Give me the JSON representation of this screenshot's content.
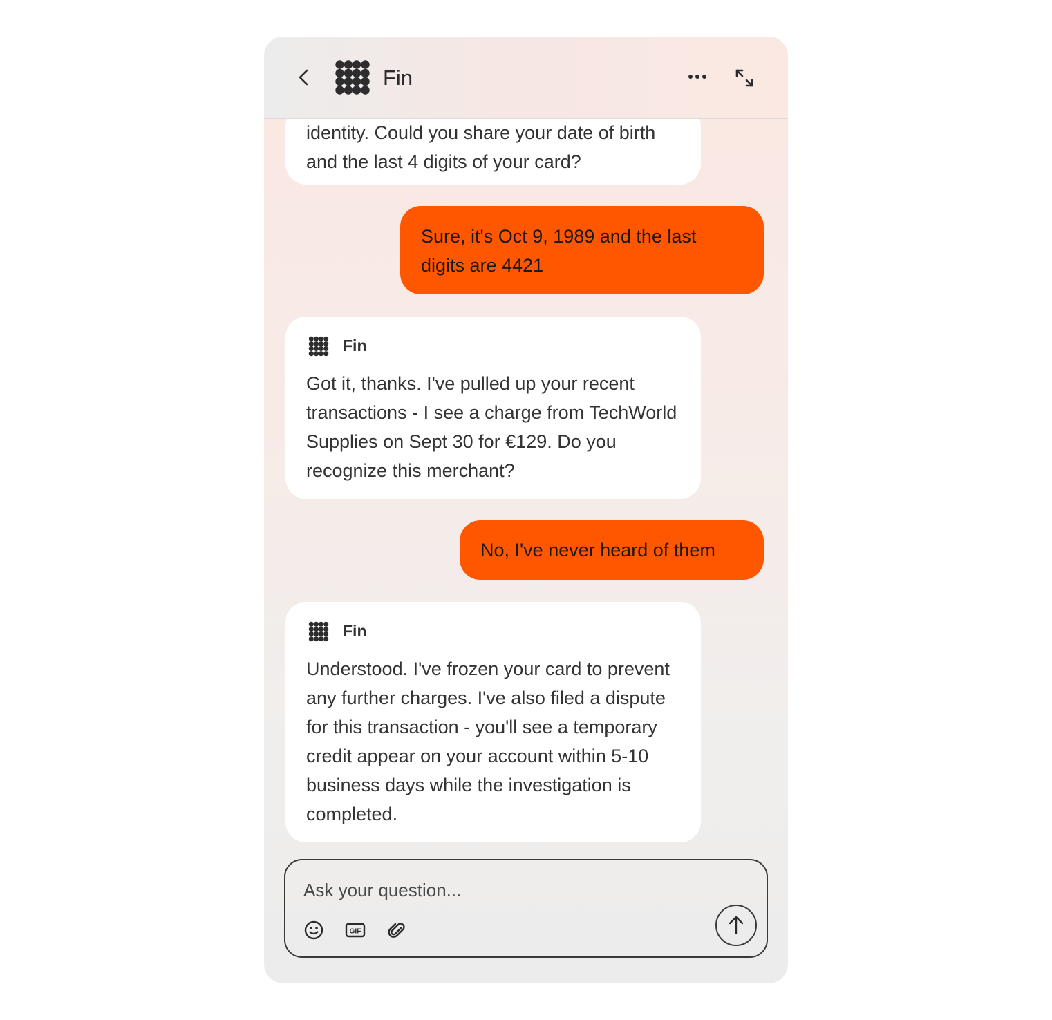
{
  "header": {
    "title": "Fin",
    "back_icon": "chevron-left-icon",
    "logo_icon": "fin-logo-icon",
    "more_icon": "more-horizontal-icon",
    "expand_icon": "expand-icon"
  },
  "messages": [
    {
      "role": "bot",
      "show_header": false,
      "text": "identity. Could you share your date of birth and the last 4 digits of your card?"
    },
    {
      "role": "user",
      "text": "Sure, it's Oct 9, 1989 and the last digits are 4421"
    },
    {
      "role": "bot",
      "show_header": true,
      "sender": "Fin",
      "text": "Got it, thanks. I've pulled up your recent transactions - I see a charge from TechWorld Supplies on Sept 30 for €129. Do you recognize this merchant?"
    },
    {
      "role": "user",
      "text": "No, I've never heard of them"
    },
    {
      "role": "bot",
      "show_header": true,
      "sender": "Fin",
      "text": "Understood. I've frozen your card to prevent any further charges. I've also filed a dispute for this transaction - you'll see a temporary credit appear on your account within 5-10 business days while the investigation is completed."
    }
  ],
  "composer": {
    "placeholder": "Ask your question...",
    "value": "",
    "tools": [
      "emoji-icon",
      "gif-icon",
      "paperclip-icon"
    ],
    "send_icon": "arrow-up-icon"
  },
  "colors": {
    "accent": "#ff5600",
    "bot_bubble": "#ffffff",
    "text": "#2c2c2c"
  }
}
